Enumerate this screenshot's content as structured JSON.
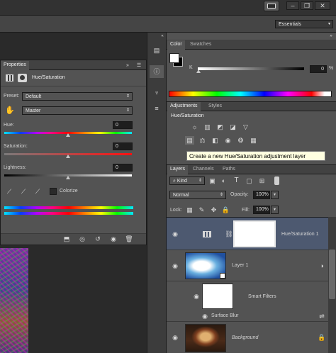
{
  "workspace": {
    "label": "Essentials",
    "arrow": "▾"
  },
  "window_controls": {
    "minimize": "–",
    "restore": "❐",
    "close": "✕"
  },
  "properties": {
    "title": "Properties",
    "header_title": "Hue/Saturation",
    "preset_label": "Preset:",
    "preset_value": "Default",
    "channel_value": "Master",
    "hue_label": "Hue:",
    "hue_value": "0",
    "saturation_label": "Saturation:",
    "saturation_value": "0",
    "lightness_label": "Lightness:",
    "lightness_value": "0",
    "colorize_label": "Colorize"
  },
  "color_panel": {
    "tab_color": "Color",
    "tab_swatches": "Swatches",
    "k_label": "K",
    "k_value": "0",
    "k_unit": "%"
  },
  "adjustments": {
    "tab_adjustments": "Adjustments",
    "tab_styles": "Styles",
    "subtitle": "Hue/Saturation",
    "tooltip": "Create a new Hue/Saturation adjustment layer"
  },
  "layers_panel": {
    "tab_layers": "Layers",
    "tab_channels": "Channels",
    "tab_paths": "Paths",
    "kind_label": "Kind",
    "blend_mode": "Normal",
    "opacity_label": "Opacity:",
    "opacity_value": "100%",
    "lock_label": "Lock:",
    "fill_label": "Fill:",
    "fill_value": "100%",
    "layers": [
      {
        "name": "Hue/Saturation 1"
      },
      {
        "name": "Layer 1"
      },
      {
        "name": "Smart Filters"
      },
      {
        "name": "Surface Blur"
      },
      {
        "name": "Background"
      }
    ]
  },
  "colors": {
    "panel_bg": "#535353",
    "header_bg": "#424242",
    "selected_layer": "#4d5970",
    "tooltip_bg": "#ffffe0"
  }
}
